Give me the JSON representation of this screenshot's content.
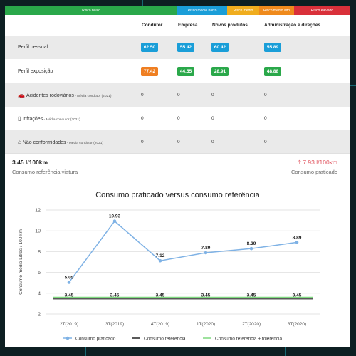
{
  "risk_bar": [
    {
      "label": "Risco baixo",
      "color": "#2aa84a"
    },
    {
      "label": "Risco médio baixo",
      "color": "#1a9ed8"
    },
    {
      "label": "Risco médio",
      "color": "#f0ad1e"
    },
    {
      "label": "Risco médio alto",
      "color": "#ef8a1c"
    },
    {
      "label": "Risco elevado",
      "color": "#d9303a"
    }
  ],
  "table": {
    "columns": [
      "Condutor",
      "Empresa",
      "Novos produtos",
      "Administração e direções"
    ],
    "rows": [
      {
        "label": "Perfil pessoal",
        "sub": "",
        "icon": "",
        "values": [
          "62.50",
          "55.42",
          "60.42",
          "55.89"
        ],
        "colors": [
          "#1a9ed8",
          "#1a9ed8",
          "#1a9ed8",
          "#1a9ed8"
        ]
      },
      {
        "label": "Perfil exposição",
        "sub": "",
        "icon": "",
        "values": [
          "77.42",
          "44.55",
          "28.91",
          "48.88"
        ],
        "colors": [
          "#ef7f22",
          "#2aa84a",
          "#2aa84a",
          "#2aa84a"
        ]
      },
      {
        "label": "Acidentes rodoviários",
        "sub": " - Média condutor (2021)",
        "icon": "car-crash-icon",
        "values": [
          "0",
          "0",
          "0",
          "0"
        ]
      },
      {
        "label": "Infrações",
        "sub": " - Média condutor (2021)",
        "icon": "traffic-light-icon",
        "values": [
          "0",
          "0",
          "0",
          "0"
        ]
      },
      {
        "label": "Não conformidades",
        "sub": " - Média condutor (2021)",
        "icon": "warehouse-icon",
        "values": [
          "0",
          "0",
          "0",
          "0"
        ]
      }
    ]
  },
  "stats": {
    "reference_value": "3.45 l/100km",
    "reference_label": "Consumo referência viatura",
    "practiced_value": "7.93 l/100km",
    "practiced_label": "Consumo praticado",
    "practiced_icon": "arrow-up-icon",
    "practiced_color": "#e0525d"
  },
  "chart_data": {
    "type": "line",
    "title": "Consumo praticado versus consumo referência",
    "ylabel": "Consumo médio Litros / 100 km",
    "xlabel": "",
    "categories": [
      "2T(2019)",
      "3T(2019)",
      "4T(2019)",
      "1T(2020)",
      "2T(2020)",
      "3T(2020)"
    ],
    "ylim": [
      2,
      12
    ],
    "yticks": [
      2,
      4,
      6,
      8,
      10,
      12
    ],
    "grid": true,
    "legend_position": "bottom",
    "series": [
      {
        "name": "Consumo praticado",
        "values": [
          5.05,
          10.93,
          7.12,
          7.89,
          8.29,
          8.89
        ],
        "labels": [
          "5.05",
          "10.93",
          "7.12",
          "7.89",
          "8.29",
          "8.89"
        ],
        "color": "#7fb2e5"
      },
      {
        "name": "Consumo referência",
        "values": [
          3.45,
          3.45,
          3.45,
          3.45,
          3.45,
          3.45
        ],
        "labels": [
          "3.45",
          "3.45",
          "3.45",
          "3.45",
          "3.45",
          "3.45"
        ],
        "color": "#222222"
      },
      {
        "name": "Consumo referência + tolerência",
        "values": [
          3.62,
          3.62,
          3.62,
          3.62,
          3.62,
          3.62
        ],
        "color": "#7ed87e"
      }
    ]
  }
}
